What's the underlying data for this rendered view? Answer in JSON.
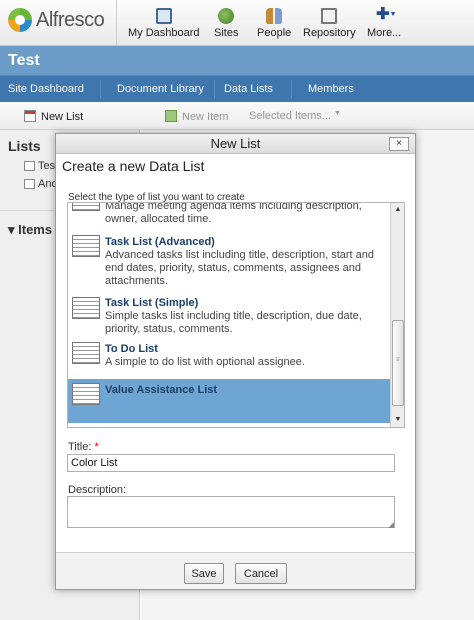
{
  "header": {
    "logo_text": "Alfresco",
    "nav": [
      {
        "label": "My Dashboard",
        "icon": "dashboard-icon"
      },
      {
        "label": "Sites",
        "icon": "sites-icon"
      },
      {
        "label": "People",
        "icon": "people-icon"
      },
      {
        "label": "Repository",
        "icon": "repository-icon"
      },
      {
        "label": "More...",
        "icon": "plus-icon"
      }
    ]
  },
  "site": {
    "title": "Test"
  },
  "tabs": [
    "Site Dashboard",
    "Document Library",
    "Data Lists",
    "Members"
  ],
  "toolbar": {
    "new_list": "New List",
    "new_item": "New Item",
    "selected_items": "Selected Items..."
  },
  "left_panel": {
    "lists_heading": "Lists",
    "lists": [
      "Tes",
      "Ano"
    ],
    "items_heading": "Items"
  },
  "dialog": {
    "title": "New List",
    "close": "×",
    "heading": "Create a new Data List",
    "select_prompt": "Select the type of list you want to create",
    "types": [
      {
        "name": "",
        "description": "Manage meeting agenda items including description, owner, allocated time."
      },
      {
        "name": "Task List (Advanced)",
        "description": "Advanced tasks list including title, description, start and end dates, priority, status, comments, assignees and attachments."
      },
      {
        "name": "Task List (Simple)",
        "description": "Simple tasks list including title, description, due date, priority, status, comments."
      },
      {
        "name": "To Do List",
        "description": "A simple to do list with optional assignee."
      },
      {
        "name": "Value Assistance List",
        "description": ""
      }
    ],
    "title_label": "Title:",
    "required_mark": "*",
    "title_value": "Color List",
    "description_label": "Description:",
    "description_value": "",
    "save": "Save",
    "cancel": "Cancel"
  },
  "colors": {
    "site_bar": "#6b9bc7",
    "tab_bar": "#3e76ad",
    "selected": "#6fa5d3"
  }
}
